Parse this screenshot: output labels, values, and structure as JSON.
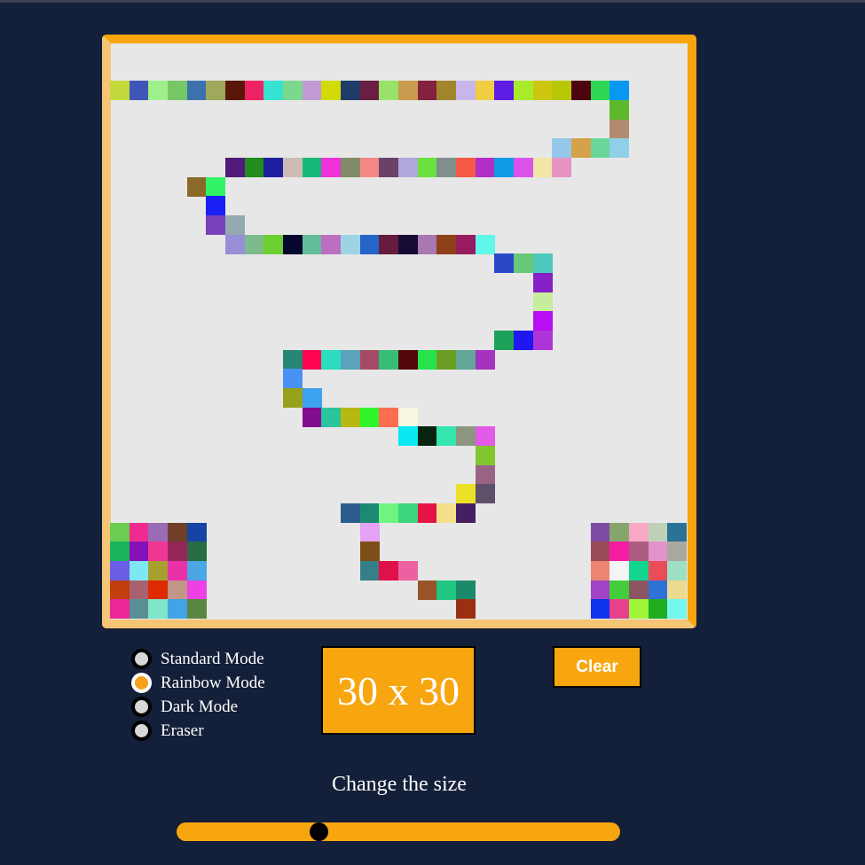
{
  "modes": [
    {
      "label": "Standard Mode",
      "checked": false
    },
    {
      "label": "Rainbow Mode",
      "checked": true
    },
    {
      "label": "Dark Mode",
      "checked": false
    },
    {
      "label": "Eraser",
      "checked": false
    }
  ],
  "size_display": "30 x 30",
  "clear_label": "Clear",
  "size_label": "Change the size",
  "slider": {
    "value": 30,
    "min": 1,
    "max": 100
  },
  "colors": {
    "background": "#142039",
    "accent": "#f8a60f",
    "canvas": "#e7e7e7"
  },
  "grid": {
    "columns": 30,
    "rows": 30,
    "painted": [
      {
        "r": 2,
        "c": 0,
        "color": "#c2d83b"
      },
      {
        "r": 2,
        "c": 1,
        "color": "#3f56b8"
      },
      {
        "r": 2,
        "c": 2,
        "color": "#9ff08a"
      },
      {
        "r": 2,
        "c": 3,
        "color": "#76c866"
      },
      {
        "r": 2,
        "c": 4,
        "color": "#3b72ae"
      },
      {
        "r": 2,
        "c": 5,
        "color": "#9fa85b"
      },
      {
        "r": 2,
        "c": 6,
        "color": "#5a1708"
      },
      {
        "r": 2,
        "c": 7,
        "color": "#ee2364"
      },
      {
        "r": 2,
        "c": 8,
        "color": "#36e3d3"
      },
      {
        "r": 2,
        "c": 9,
        "color": "#7bd88c"
      },
      {
        "r": 2,
        "c": 10,
        "color": "#c19ad3"
      },
      {
        "r": 2,
        "c": 11,
        "color": "#d2db08"
      },
      {
        "r": 2,
        "c": 12,
        "color": "#1f3b67"
      },
      {
        "r": 2,
        "c": 13,
        "color": "#6b1e43"
      },
      {
        "r": 2,
        "c": 14,
        "color": "#98e26a"
      },
      {
        "r": 2,
        "c": 15,
        "color": "#c99b4e"
      },
      {
        "r": 2,
        "c": 16,
        "color": "#83213e"
      },
      {
        "r": 2,
        "c": 17,
        "color": "#a1862e"
      },
      {
        "r": 2,
        "c": 18,
        "color": "#c8b5eb"
      },
      {
        "r": 2,
        "c": 19,
        "color": "#f1cd42"
      },
      {
        "r": 2,
        "c": 20,
        "color": "#5d1de5"
      },
      {
        "r": 2,
        "c": 21,
        "color": "#a7eb2a"
      },
      {
        "r": 2,
        "c": 22,
        "color": "#cdc70f"
      },
      {
        "r": 2,
        "c": 23,
        "color": "#b9c806"
      },
      {
        "r": 2,
        "c": 24,
        "color": "#4d0410"
      },
      {
        "r": 2,
        "c": 25,
        "color": "#2fd653"
      },
      {
        "r": 2,
        "c": 26,
        "color": "#0a97f2"
      },
      {
        "r": 3,
        "c": 26,
        "color": "#5db82b"
      },
      {
        "r": 4,
        "c": 26,
        "color": "#b18b6f"
      },
      {
        "r": 5,
        "c": 23,
        "color": "#95c8e8"
      },
      {
        "r": 5,
        "c": 24,
        "color": "#d5a249"
      },
      {
        "r": 5,
        "c": 25,
        "color": "#6ad69a"
      },
      {
        "r": 5,
        "c": 26,
        "color": "#90cfe8"
      },
      {
        "r": 6,
        "c": 6,
        "color": "#4f1a7b"
      },
      {
        "r": 6,
        "c": 7,
        "color": "#208d1c"
      },
      {
        "r": 6,
        "c": 8,
        "color": "#1c20a0"
      },
      {
        "r": 6,
        "c": 9,
        "color": "#ccbcb5"
      },
      {
        "r": 6,
        "c": 10,
        "color": "#15b878"
      },
      {
        "r": 6,
        "c": 11,
        "color": "#ed32d8"
      },
      {
        "r": 6,
        "c": 12,
        "color": "#818c68"
      },
      {
        "r": 6,
        "c": 13,
        "color": "#f38886"
      },
      {
        "r": 6,
        "c": 14,
        "color": "#6a4168"
      },
      {
        "r": 6,
        "c": 15,
        "color": "#b2a7dc"
      },
      {
        "r": 6,
        "c": 16,
        "color": "#6ae13c"
      },
      {
        "r": 6,
        "c": 17,
        "color": "#7f8f8c"
      },
      {
        "r": 6,
        "c": 18,
        "color": "#f55a48"
      },
      {
        "r": 6,
        "c": 19,
        "color": "#b32ec6"
      },
      {
        "r": 6,
        "c": 20,
        "color": "#0d9be6"
      },
      {
        "r": 6,
        "c": 21,
        "color": "#db52eb"
      },
      {
        "r": 6,
        "c": 22,
        "color": "#f1e6a6"
      },
      {
        "r": 6,
        "c": 23,
        "color": "#e493c3"
      },
      {
        "r": 7,
        "c": 4,
        "color": "#8b6a29"
      },
      {
        "r": 7,
        "c": 5,
        "color": "#30f365"
      },
      {
        "r": 8,
        "c": 5,
        "color": "#1a1ff3"
      },
      {
        "r": 9,
        "c": 5,
        "color": "#7a41bb"
      },
      {
        "r": 9,
        "c": 6,
        "color": "#94aab0"
      },
      {
        "r": 10,
        "c": 6,
        "color": "#998fd8"
      },
      {
        "r": 10,
        "c": 7,
        "color": "#7ebb8c"
      },
      {
        "r": 10,
        "c": 8,
        "color": "#6bcf2f"
      },
      {
        "r": 10,
        "c": 9,
        "color": "#060731"
      },
      {
        "r": 10,
        "c": 10,
        "color": "#62bd9b"
      },
      {
        "r": 10,
        "c": 11,
        "color": "#bc6ec0"
      },
      {
        "r": 10,
        "c": 12,
        "color": "#9dd4e4"
      },
      {
        "r": 10,
        "c": 13,
        "color": "#2564c9"
      },
      {
        "r": 10,
        "c": 14,
        "color": "#651c3d"
      },
      {
        "r": 10,
        "c": 15,
        "color": "#160b35"
      },
      {
        "r": 10,
        "c": 16,
        "color": "#a977b1"
      },
      {
        "r": 10,
        "c": 17,
        "color": "#8e4019"
      },
      {
        "r": 10,
        "c": 18,
        "color": "#971b5f"
      },
      {
        "r": 10,
        "c": 19,
        "color": "#5ff8ea"
      },
      {
        "r": 11,
        "c": 20,
        "color": "#2b48c6"
      },
      {
        "r": 11,
        "c": 21,
        "color": "#68c77b"
      },
      {
        "r": 11,
        "c": 22,
        "color": "#4ec9be"
      },
      {
        "r": 12,
        "c": 22,
        "color": "#8521c6"
      },
      {
        "r": 13,
        "c": 22,
        "color": "#c7ec9c"
      },
      {
        "r": 14,
        "c": 22,
        "color": "#b80ef1"
      },
      {
        "r": 15,
        "c": 20,
        "color": "#1ea259"
      },
      {
        "r": 15,
        "c": 21,
        "color": "#2017f0"
      },
      {
        "r": 15,
        "c": 22,
        "color": "#ad35d7"
      },
      {
        "r": 16,
        "c": 9,
        "color": "#268573"
      },
      {
        "r": 16,
        "c": 10,
        "color": "#fe0552"
      },
      {
        "r": 16,
        "c": 11,
        "color": "#2bdcbe"
      },
      {
        "r": 16,
        "c": 12,
        "color": "#5aa3bb"
      },
      {
        "r": 16,
        "c": 13,
        "color": "#a54a65"
      },
      {
        "r": 16,
        "c": 14,
        "color": "#37bd75"
      },
      {
        "r": 16,
        "c": 15,
        "color": "#530708"
      },
      {
        "r": 16,
        "c": 16,
        "color": "#26e24b"
      },
      {
        "r": 16,
        "c": 17,
        "color": "#6b9f23"
      },
      {
        "r": 16,
        "c": 18,
        "color": "#63a69b"
      },
      {
        "r": 16,
        "c": 19,
        "color": "#a433c0"
      },
      {
        "r": 17,
        "c": 9,
        "color": "#4a91f6"
      },
      {
        "r": 18,
        "c": 9,
        "color": "#98a11b"
      },
      {
        "r": 18,
        "c": 10,
        "color": "#3aa2f0"
      },
      {
        "r": 19,
        "c": 10,
        "color": "#830d90"
      },
      {
        "r": 19,
        "c": 11,
        "color": "#2bc49c"
      },
      {
        "r": 19,
        "c": 12,
        "color": "#b5b911"
      },
      {
        "r": 19,
        "c": 13,
        "color": "#30f52d"
      },
      {
        "r": 19,
        "c": 14,
        "color": "#fe6d4f"
      },
      {
        "r": 19,
        "c": 15,
        "color": "#f9f7e1"
      },
      {
        "r": 20,
        "c": 15,
        "color": "#0ae8f1"
      },
      {
        "r": 20,
        "c": 16,
        "color": "#08240f"
      },
      {
        "r": 20,
        "c": 17,
        "color": "#34e6ae"
      },
      {
        "r": 20,
        "c": 18,
        "color": "#8c9680"
      },
      {
        "r": 20,
        "c": 19,
        "color": "#e25ae8"
      },
      {
        "r": 21,
        "c": 19,
        "color": "#81c62e"
      },
      {
        "r": 22,
        "c": 19,
        "color": "#9a6386"
      },
      {
        "r": 23,
        "c": 18,
        "color": "#ece029"
      },
      {
        "r": 23,
        "c": 19,
        "color": "#5e4f6a"
      },
      {
        "r": 24,
        "c": 12,
        "color": "#2b5e8c"
      },
      {
        "r": 24,
        "c": 13,
        "color": "#1c8a70"
      },
      {
        "r": 24,
        "c": 14,
        "color": "#6ef57f"
      },
      {
        "r": 24,
        "c": 15,
        "color": "#3cd67e"
      },
      {
        "r": 24,
        "c": 16,
        "color": "#e41447"
      },
      {
        "r": 24,
        "c": 17,
        "color": "#f4e08a"
      },
      {
        "r": 24,
        "c": 18,
        "color": "#441f62"
      },
      {
        "r": 25,
        "c": 13,
        "color": "#e3a2f5"
      },
      {
        "r": 26,
        "c": 13,
        "color": "#7d4e17"
      },
      {
        "r": 27,
        "c": 13,
        "color": "#358088"
      },
      {
        "r": 27,
        "c": 14,
        "color": "#e0104a"
      },
      {
        "r": 27,
        "c": 15,
        "color": "#ec62a1"
      },
      {
        "r": 28,
        "c": 16,
        "color": "#98552a"
      },
      {
        "r": 28,
        "c": 17,
        "color": "#22c683"
      },
      {
        "r": 28,
        "c": 18,
        "color": "#1b8a6b"
      },
      {
        "r": 29,
        "c": 18,
        "color": "#9b2f12"
      },
      {
        "r": 25,
        "c": 0,
        "color": "#6bcd51"
      },
      {
        "r": 25,
        "c": 1,
        "color": "#ef2a91"
      },
      {
        "r": 25,
        "c": 2,
        "color": "#9b6bb6"
      },
      {
        "r": 25,
        "c": 3,
        "color": "#6f3f28"
      },
      {
        "r": 25,
        "c": 4,
        "color": "#1644a4"
      },
      {
        "r": 26,
        "c": 0,
        "color": "#1ab45c"
      },
      {
        "r": 26,
        "c": 1,
        "color": "#8412b8"
      },
      {
        "r": 26,
        "c": 2,
        "color": "#ef3693"
      },
      {
        "r": 26,
        "c": 3,
        "color": "#952659"
      },
      {
        "r": 26,
        "c": 4,
        "color": "#276c43"
      },
      {
        "r": 27,
        "c": 0,
        "color": "#6a5ee7"
      },
      {
        "r": 27,
        "c": 1,
        "color": "#7ee8f2"
      },
      {
        "r": 27,
        "c": 2,
        "color": "#a6a030"
      },
      {
        "r": 27,
        "c": 3,
        "color": "#e932a8"
      },
      {
        "r": 27,
        "c": 4,
        "color": "#4aa6e5"
      },
      {
        "r": 28,
        "c": 0,
        "color": "#c03f0d"
      },
      {
        "r": 28,
        "c": 1,
        "color": "#a86170"
      },
      {
        "r": 28,
        "c": 2,
        "color": "#dd2a01"
      },
      {
        "r": 28,
        "c": 3,
        "color": "#c29586"
      },
      {
        "r": 28,
        "c": 4,
        "color": "#ee40e4"
      },
      {
        "r": 29,
        "c": 0,
        "color": "#ec2796"
      },
      {
        "r": 29,
        "c": 1,
        "color": "#5a8f96"
      },
      {
        "r": 29,
        "c": 2,
        "color": "#7fe6c9"
      },
      {
        "r": 29,
        "c": 3,
        "color": "#42a3e6"
      },
      {
        "r": 29,
        "c": 4,
        "color": "#5a8640"
      },
      {
        "r": 25,
        "c": 25,
        "color": "#7d4ba6"
      },
      {
        "r": 25,
        "c": 26,
        "color": "#86a66e"
      },
      {
        "r": 25,
        "c": 27,
        "color": "#f7a8c6"
      },
      {
        "r": 25,
        "c": 28,
        "color": "#bfd2b7"
      },
      {
        "r": 25,
        "c": 29,
        "color": "#2a7396"
      },
      {
        "r": 26,
        "c": 25,
        "color": "#9b4b57"
      },
      {
        "r": 26,
        "c": 26,
        "color": "#f51ea2"
      },
      {
        "r": 26,
        "c": 27,
        "color": "#ae5b82"
      },
      {
        "r": 26,
        "c": 28,
        "color": "#e393c8"
      },
      {
        "r": 26,
        "c": 29,
        "color": "#a8a9a1"
      },
      {
        "r": 27,
        "c": 25,
        "color": "#ec8571"
      },
      {
        "r": 27,
        "c": 26,
        "color": "#f4f4f4"
      },
      {
        "r": 27,
        "c": 27,
        "color": "#12d68d"
      },
      {
        "r": 27,
        "c": 28,
        "color": "#ea4c59"
      },
      {
        "r": 27,
        "c": 29,
        "color": "#9ee0c4"
      },
      {
        "r": 28,
        "c": 25,
        "color": "#a143c4"
      },
      {
        "r": 28,
        "c": 26,
        "color": "#43cd3c"
      },
      {
        "r": 28,
        "c": 27,
        "color": "#8b5662"
      },
      {
        "r": 28,
        "c": 28,
        "color": "#2e72d6"
      },
      {
        "r": 28,
        "c": 29,
        "color": "#eadb90"
      },
      {
        "r": 29,
        "c": 25,
        "color": "#0f34ee"
      },
      {
        "r": 29,
        "c": 26,
        "color": "#e7408c"
      },
      {
        "r": 29,
        "c": 27,
        "color": "#9ff53a"
      },
      {
        "r": 29,
        "c": 28,
        "color": "#20ad1f"
      },
      {
        "r": 29,
        "c": 29,
        "color": "#72f8ef"
      }
    ]
  }
}
